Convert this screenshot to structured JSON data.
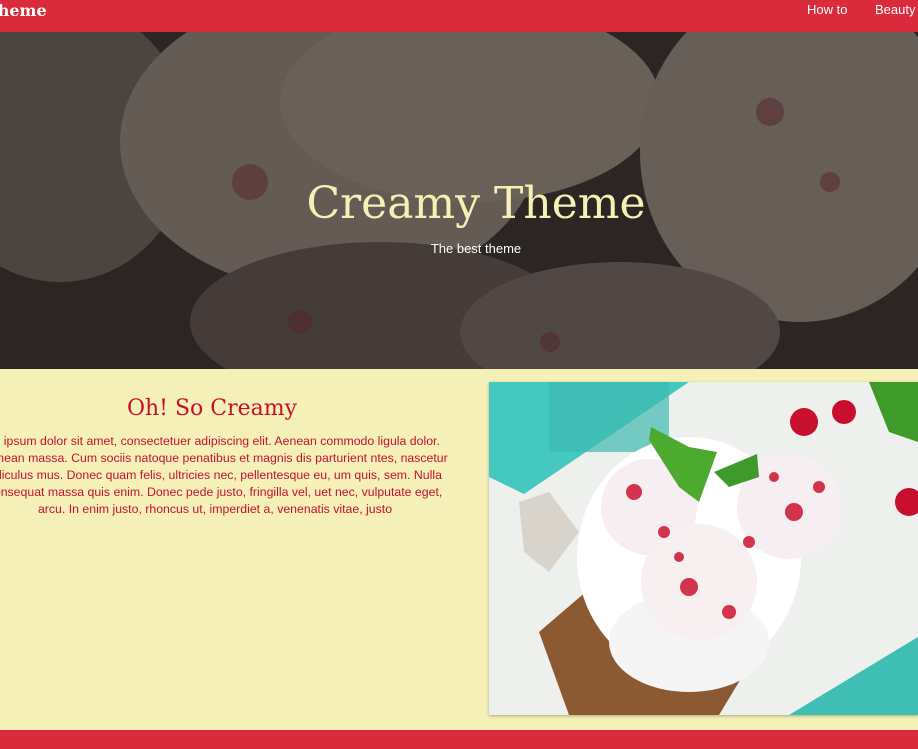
{
  "navbar": {
    "brand": "my Theme",
    "links": [
      "How to",
      "Beauty"
    ]
  },
  "hero": {
    "title": "Creamy Theme",
    "subtitle": "The best theme"
  },
  "section": {
    "title": "Oh! So Creamy",
    "body": "m ipsum dolor sit amet, consectetuer adipiscing elit. Aenean commodo ligula dolor. Aenean massa. Cum sociis natoque penatibus et magnis dis parturient ntes, nascetur ridiculus mus. Donec quam felis, ultricies nec, pellentesque eu, um quis, sem. Nulla consequat massa quis enim. Donec pede justo, fringilla vel, uet nec, vulputate eget, arcu. In enim justo, rhoncus ut, imperdiet a, venenatis vitae, justo"
  },
  "colors": {
    "primary": "#d92b3c",
    "background": "#f5f0b8",
    "accent_text": "#c8102e",
    "hero_title": "#f7f0b4"
  }
}
